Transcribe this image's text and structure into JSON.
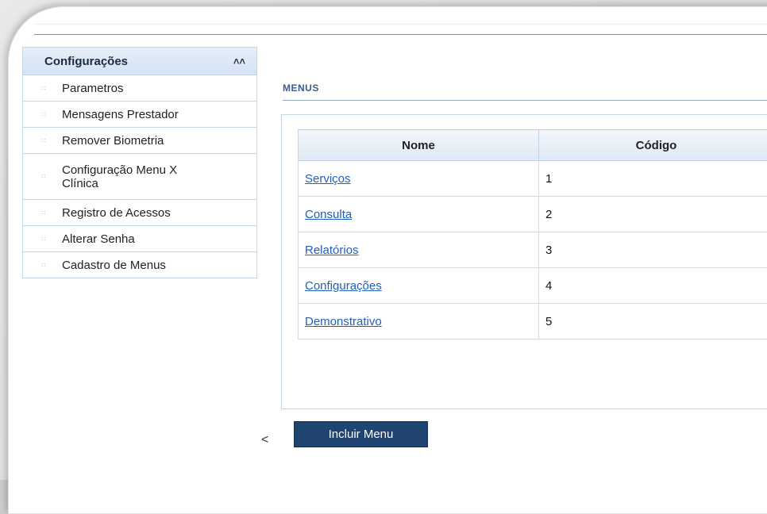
{
  "sidebar": {
    "title": "Configurações",
    "collapse_icon": "double-chevron-up",
    "items": [
      {
        "label": "Parametros"
      },
      {
        "label": "Mensagens Prestador"
      },
      {
        "label": "Remover Biometria"
      },
      {
        "label": "Configuração Menu X Clínica"
      },
      {
        "label": "Registro de Acessos"
      },
      {
        "label": "Alterar Senha"
      },
      {
        "label": "Cadastro de Menus"
      }
    ]
  },
  "main": {
    "section_title": "MENUS",
    "table": {
      "headers": [
        "Nome",
        "Código"
      ],
      "rows": [
        {
          "nome": "Serviços",
          "codigo": "1"
        },
        {
          "nome": "Consulta",
          "codigo": "2"
        },
        {
          "nome": "Relatórios",
          "codigo": "3"
        },
        {
          "nome": "Configurações",
          "codigo": "4"
        },
        {
          "nome": "Demonstrativo",
          "codigo": "5"
        }
      ]
    },
    "back_label": "<",
    "add_button_label": "Incluir Menu"
  },
  "colors": {
    "accent": "#1f4470",
    "link": "#1f5fbf",
    "border": "#c4d3e6"
  }
}
